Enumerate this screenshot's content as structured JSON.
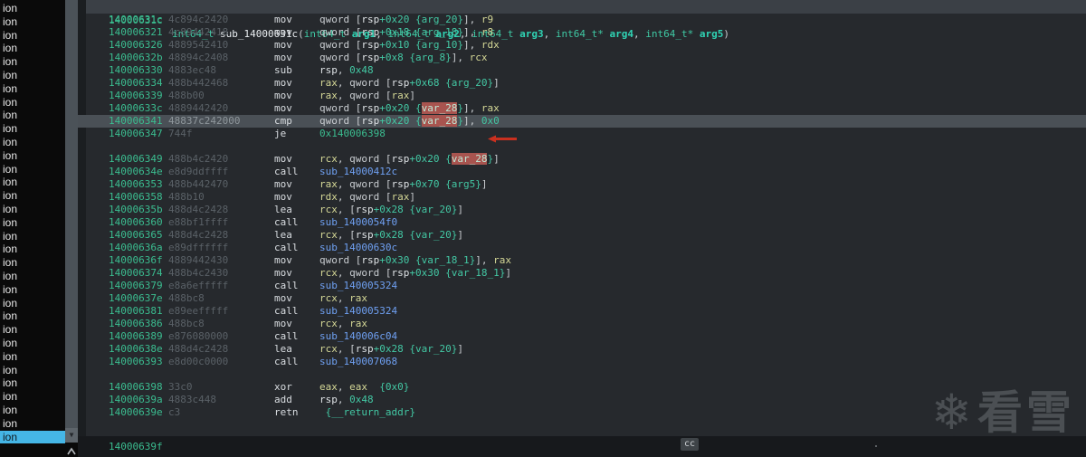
{
  "colors": {
    "address": "#3bbd90",
    "bytes": "#5a6167",
    "selected_row_bg": "#4a5056",
    "var_highlight_bg": "#a8544f",
    "sidebar_selected_bg": "#45b6e6",
    "function_ref": "#6fa0f2",
    "immediate": "#43c8a4",
    "annotation_arrow": "#c9301f"
  },
  "sidebar": {
    "item_label": "ion",
    "item_count": 33,
    "selected_index": 32,
    "dropdown_icon": "chevron-down-icon",
    "dropdown_glyph": "▼",
    "scroll_up_icon": "chevron-up-icon"
  },
  "header": {
    "address": "14000631c",
    "tokens": [
      [
        "t",
        "int64_t"
      ],
      [
        "p",
        " "
      ],
      [
        "w",
        "sub_14000631c"
      ],
      [
        "p",
        "("
      ],
      [
        "t",
        "int64_t"
      ],
      [
        "p",
        " "
      ],
      [
        "ab",
        "arg1"
      ],
      [
        "p",
        ", "
      ],
      [
        "t",
        "int64_t"
      ],
      [
        "p",
        " "
      ],
      [
        "ab",
        "arg2"
      ],
      [
        "p",
        ", "
      ],
      [
        "t",
        "int64_t"
      ],
      [
        "p",
        " "
      ],
      [
        "ab",
        "arg3"
      ],
      [
        "p",
        ", "
      ],
      [
        "t",
        "int64_t*"
      ],
      [
        "p",
        " "
      ],
      [
        "ab",
        "arg4"
      ],
      [
        "p",
        ", "
      ],
      [
        "t",
        "int64_t*"
      ],
      [
        "p",
        " "
      ],
      [
        "ab",
        "arg5"
      ],
      [
        "p",
        ")"
      ]
    ]
  },
  "listing": {
    "rows": [
      {
        "a": "14000631c",
        "b": "4c894c2420",
        "m": "mov",
        "o": [
          [
            "p",
            "qword ["
          ],
          [
            "s",
            "rsp"
          ],
          [
            "n",
            "+0x20"
          ],
          [
            "p",
            " "
          ],
          [
            "v",
            "{arg_20}"
          ],
          [
            "p",
            "], "
          ],
          [
            "r",
            "r9"
          ]
        ]
      },
      {
        "a": "140006321",
        "b": "4c89442418",
        "m": "mov",
        "o": [
          [
            "p",
            "qword ["
          ],
          [
            "s",
            "rsp"
          ],
          [
            "n",
            "+0x18"
          ],
          [
            "p",
            " "
          ],
          [
            "v",
            "{arg_18}"
          ],
          [
            "p",
            "], "
          ],
          [
            "r",
            "r8"
          ]
        ]
      },
      {
        "a": "140006326",
        "b": "4889542410",
        "m": "mov",
        "o": [
          [
            "p",
            "qword ["
          ],
          [
            "s",
            "rsp"
          ],
          [
            "n",
            "+0x10"
          ],
          [
            "p",
            " "
          ],
          [
            "v",
            "{arg_10}"
          ],
          [
            "p",
            "], "
          ],
          [
            "r",
            "rdx"
          ]
        ]
      },
      {
        "a": "14000632b",
        "b": "48894c2408",
        "m": "mov",
        "o": [
          [
            "p",
            "qword ["
          ],
          [
            "s",
            "rsp"
          ],
          [
            "n",
            "+0x8"
          ],
          [
            "p",
            " "
          ],
          [
            "v",
            "{arg_8}"
          ],
          [
            "p",
            "], "
          ],
          [
            "r",
            "rcx"
          ]
        ]
      },
      {
        "a": "140006330",
        "b": "4883ec48",
        "m": "sub",
        "o": [
          [
            "s",
            "rsp"
          ],
          [
            "p",
            ", "
          ],
          [
            "n",
            "0x48"
          ]
        ]
      },
      {
        "a": "140006334",
        "b": "488b442468",
        "m": "mov",
        "o": [
          [
            "r",
            "rax"
          ],
          [
            "p",
            ", qword ["
          ],
          [
            "s",
            "rsp"
          ],
          [
            "n",
            "+0x68"
          ],
          [
            "p",
            " "
          ],
          [
            "v",
            "{arg_20}"
          ],
          [
            "p",
            "]"
          ]
        ]
      },
      {
        "a": "140006339",
        "b": "488b00",
        "m": "mov",
        "o": [
          [
            "r",
            "rax"
          ],
          [
            "p",
            ", qword ["
          ],
          [
            "r",
            "rax"
          ],
          [
            "p",
            "]"
          ]
        ]
      },
      {
        "a": "14000633c",
        "b": "4889442420",
        "m": "mov",
        "o": [
          [
            "p",
            "qword ["
          ],
          [
            "s",
            "rsp"
          ],
          [
            "n",
            "+0x20"
          ],
          [
            "p",
            " "
          ],
          [
            "v",
            "{"
          ],
          [
            "hl",
            "var_28"
          ],
          [
            "v",
            "}"
          ],
          [
            "p",
            "], "
          ],
          [
            "r",
            "rax"
          ]
        ]
      },
      {
        "a": "140006341",
        "b": "48837c242000",
        "m": "cmp",
        "sel": true,
        "o": [
          [
            "p",
            "qword ["
          ],
          [
            "s",
            "rsp"
          ],
          [
            "n",
            "+0x20"
          ],
          [
            "p",
            " "
          ],
          [
            "v",
            "{"
          ],
          [
            "hl",
            "var_28"
          ],
          [
            "v",
            "}"
          ],
          [
            "p",
            "], "
          ],
          [
            "n",
            "0x0"
          ]
        ]
      },
      {
        "a": "140006347",
        "b": "744f",
        "m": "je",
        "o": [
          [
            "g",
            "0x140006398"
          ]
        ]
      },
      {
        "blank": true
      },
      {
        "a": "140006349",
        "b": "488b4c2420",
        "m": "mov",
        "o": [
          [
            "r",
            "rcx"
          ],
          [
            "p",
            ", qword ["
          ],
          [
            "s",
            "rsp"
          ],
          [
            "n",
            "+0x20"
          ],
          [
            "p",
            " "
          ],
          [
            "v",
            "{"
          ],
          [
            "hl",
            "var_28"
          ],
          [
            "v",
            "}"
          ],
          [
            "p",
            "]"
          ]
        ]
      },
      {
        "a": "14000634e",
        "b": "e8d9ddffff",
        "m": "call",
        "o": [
          [
            "f",
            "sub_14000412c"
          ]
        ]
      },
      {
        "a": "140006353",
        "b": "488b442470",
        "m": "mov",
        "o": [
          [
            "r",
            "rax"
          ],
          [
            "p",
            ", qword ["
          ],
          [
            "s",
            "rsp"
          ],
          [
            "n",
            "+0x70"
          ],
          [
            "p",
            " "
          ],
          [
            "v",
            "{arg5}"
          ],
          [
            "p",
            "]"
          ]
        ]
      },
      {
        "a": "140006358",
        "b": "488b10",
        "m": "mov",
        "o": [
          [
            "r",
            "rdx"
          ],
          [
            "p",
            ", qword ["
          ],
          [
            "r",
            "rax"
          ],
          [
            "p",
            "]"
          ]
        ]
      },
      {
        "a": "14000635b",
        "b": "488d4c2428",
        "m": "lea",
        "o": [
          [
            "r",
            "rcx"
          ],
          [
            "p",
            ", ["
          ],
          [
            "s",
            "rsp"
          ],
          [
            "n",
            "+0x28"
          ],
          [
            "p",
            " "
          ],
          [
            "v",
            "{var_20}"
          ],
          [
            "p",
            "]"
          ]
        ]
      },
      {
        "a": "140006360",
        "b": "e88bf1ffff",
        "m": "call",
        "o": [
          [
            "f",
            "sub_1400054f0"
          ]
        ]
      },
      {
        "a": "140006365",
        "b": "488d4c2428",
        "m": "lea",
        "o": [
          [
            "r",
            "rcx"
          ],
          [
            "p",
            ", ["
          ],
          [
            "s",
            "rsp"
          ],
          [
            "n",
            "+0x28"
          ],
          [
            "p",
            " "
          ],
          [
            "v",
            "{var_20}"
          ],
          [
            "p",
            "]"
          ]
        ]
      },
      {
        "a": "14000636a",
        "b": "e89dffffff",
        "m": "call",
        "o": [
          [
            "f",
            "sub_14000630c"
          ]
        ]
      },
      {
        "a": "14000636f",
        "b": "4889442430",
        "m": "mov",
        "o": [
          [
            "p",
            "qword ["
          ],
          [
            "s",
            "rsp"
          ],
          [
            "n",
            "+0x30"
          ],
          [
            "p",
            " "
          ],
          [
            "v",
            "{var_18_1}"
          ],
          [
            "p",
            "], "
          ],
          [
            "r",
            "rax"
          ]
        ]
      },
      {
        "a": "140006374",
        "b": "488b4c2430",
        "m": "mov",
        "o": [
          [
            "r",
            "rcx"
          ],
          [
            "p",
            ", qword ["
          ],
          [
            "s",
            "rsp"
          ],
          [
            "n",
            "+0x30"
          ],
          [
            "p",
            " "
          ],
          [
            "v",
            "{var_18_1}"
          ],
          [
            "p",
            "]"
          ]
        ]
      },
      {
        "a": "140006379",
        "b": "e8a6efffff",
        "m": "call",
        "o": [
          [
            "f",
            "sub_140005324"
          ]
        ]
      },
      {
        "a": "14000637e",
        "b": "488bc8",
        "m": "mov",
        "o": [
          [
            "r",
            "rcx"
          ],
          [
            "p",
            ", "
          ],
          [
            "r",
            "rax"
          ]
        ]
      },
      {
        "a": "140006381",
        "b": "e89eefffff",
        "m": "call",
        "o": [
          [
            "f",
            "sub_140005324"
          ]
        ]
      },
      {
        "a": "140006386",
        "b": "488bc8",
        "m": "mov",
        "o": [
          [
            "r",
            "rcx"
          ],
          [
            "p",
            ", "
          ],
          [
            "r",
            "rax"
          ]
        ]
      },
      {
        "a": "140006389",
        "b": "e876080000",
        "m": "call",
        "o": [
          [
            "f",
            "sub_140006c04"
          ]
        ]
      },
      {
        "a": "14000638e",
        "b": "488d4c2428",
        "m": "lea",
        "o": [
          [
            "r",
            "rcx"
          ],
          [
            "p",
            ", ["
          ],
          [
            "s",
            "rsp"
          ],
          [
            "n",
            "+0x28"
          ],
          [
            "p",
            " "
          ],
          [
            "v",
            "{var_20}"
          ],
          [
            "p",
            "]"
          ]
        ]
      },
      {
        "a": "140006393",
        "b": "e8d00c0000",
        "m": "call",
        "o": [
          [
            "f",
            "sub_140007068"
          ]
        ]
      },
      {
        "blank": true
      },
      {
        "a": "140006398",
        "b": "33c0",
        "m": "xor",
        "o": [
          [
            "r",
            "eax"
          ],
          [
            "p",
            ", "
          ],
          [
            "r",
            "eax"
          ],
          [
            "p",
            "  "
          ],
          [
            "v",
            "{0x0}"
          ]
        ]
      },
      {
        "a": "14000639a",
        "b": "4883c448",
        "m": "add",
        "o": [
          [
            "s",
            "rsp"
          ],
          [
            "p",
            ", "
          ],
          [
            "n",
            "0x48"
          ]
        ]
      },
      {
        "a": "14000639e",
        "b": "c3",
        "m": "retn",
        "o": [
          [
            "p",
            " "
          ],
          [
            "v",
            "{__return_addr}"
          ]
        ]
      }
    ]
  },
  "footer": {
    "next_address": "14000639f",
    "badge": "cc"
  },
  "watermark": {
    "icon": "snowflake-icon",
    "flake_glyph": "❄",
    "text": "看雪"
  }
}
